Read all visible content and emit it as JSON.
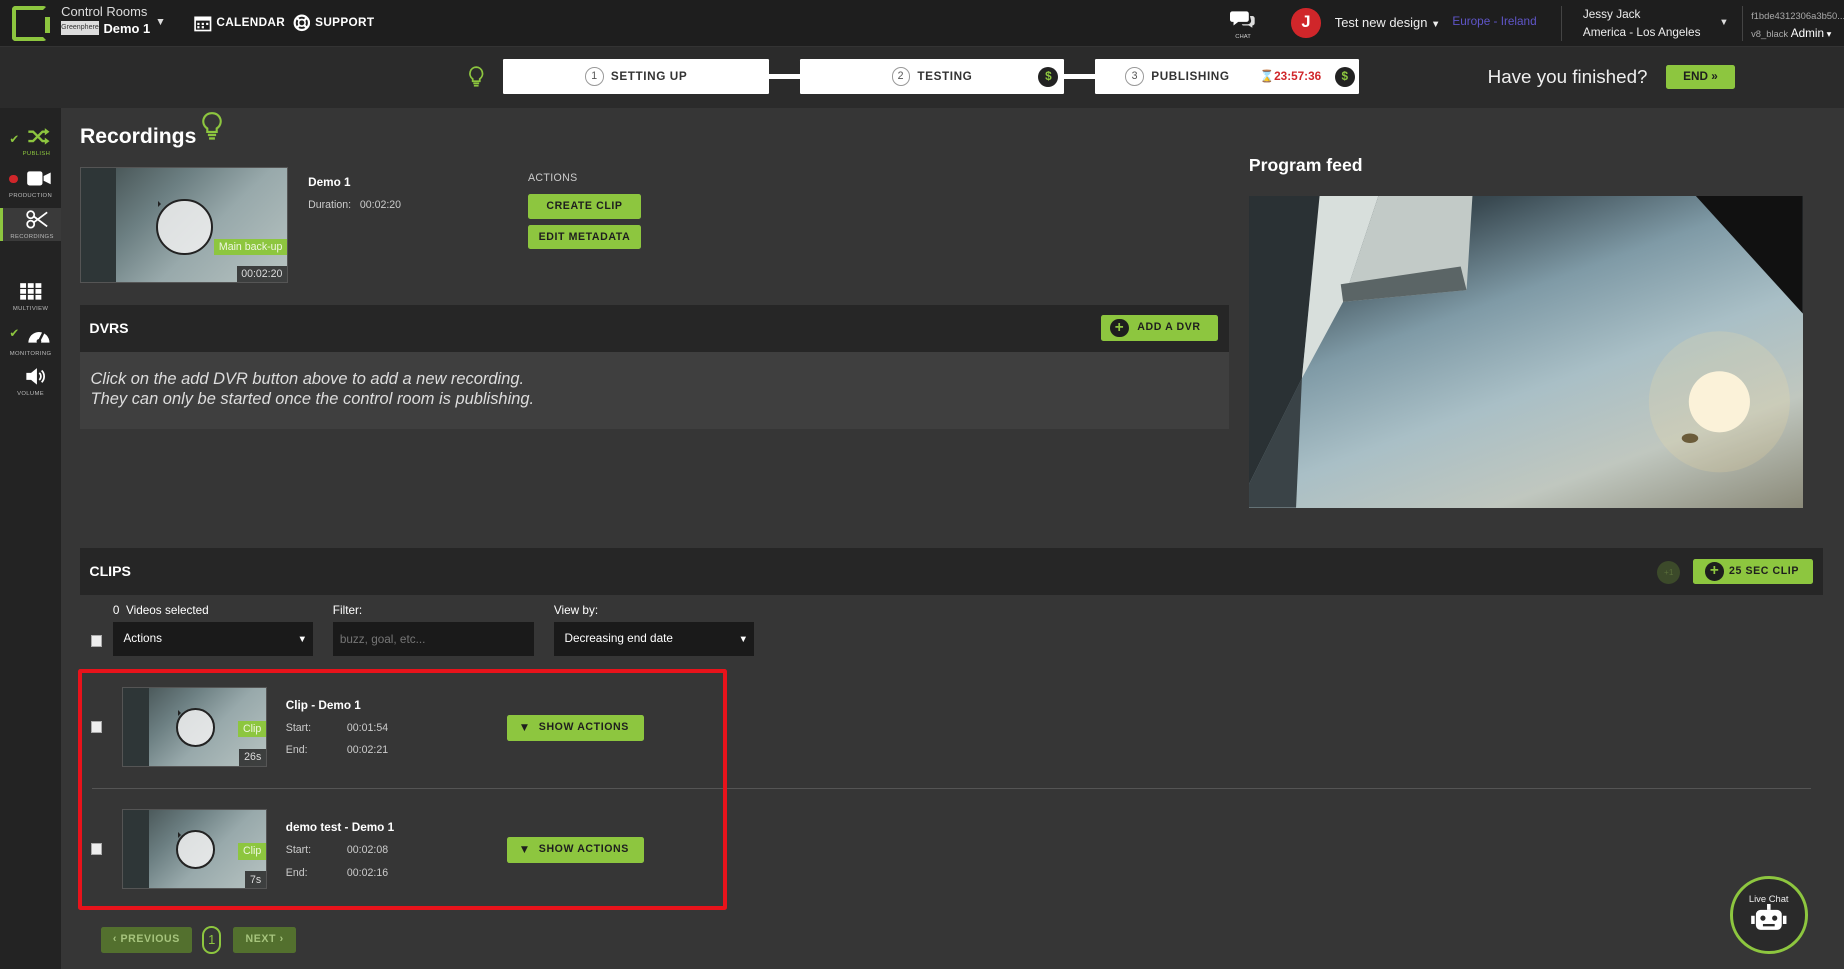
{
  "header": {
    "section_label": "Control Rooms",
    "mini_logo_text": "Greenphere",
    "room_name": "Demo 1",
    "calendar_label": "CALENDAR",
    "support_label": "SUPPORT",
    "chat_label": "CHAT",
    "avatar_letter": "J",
    "design_label": "Test new design",
    "region": "Europe - Ireland",
    "user_name": "Jessy Jack",
    "user_timezone": "America - Los Angeles",
    "instance_id": "f1bde4312306a3b50...",
    "instance_sub": "v8_black",
    "role": "Admin"
  },
  "steps": [
    {
      "num": "1",
      "label": "SETTING UP"
    },
    {
      "num": "2",
      "label": "TESTING"
    },
    {
      "num": "3",
      "label": "PUBLISHING"
    }
  ],
  "timer": "23:57:36",
  "dollar": "$",
  "finished_text": "Have you finished?",
  "end_label": "END",
  "sidebar": [
    {
      "label": "PUBLISH"
    },
    {
      "label": "PRODUCTION"
    },
    {
      "label": "RECORDINGS"
    },
    {
      "label": "MULTIVIEW"
    },
    {
      "label": "MONITORING"
    },
    {
      "label": "VOLUME"
    }
  ],
  "recordings": {
    "title": "Recordings",
    "item": {
      "tag": "Main back-up",
      "duration_badge": "00:02:20",
      "name": "Demo 1",
      "duration_label": "Duration:",
      "duration_value": "00:02:20"
    },
    "actions_heading": "ACTIONS",
    "create_clip": "CREATE CLIP",
    "edit_metadata": "EDIT METADATA"
  },
  "dvrs": {
    "title": "DVRS",
    "add_label": "ADD A DVR",
    "message_line1": "Click on the add DVR button above to add a new recording.",
    "message_line2": "They can only be started once the control room is publishing."
  },
  "program_feed": {
    "title": "Program feed"
  },
  "clips": {
    "title": "CLIPS",
    "plus_badge": "+1",
    "clip_button": "25 SEC CLIP",
    "selected_count": "0",
    "selected_label": "Videos selected",
    "actions_select": "Actions",
    "filter_label": "Filter:",
    "filter_placeholder": "buzz, goal, etc...",
    "viewby_label": "View by:",
    "viewby_value": "Decreasing end date",
    "items": [
      {
        "name": "Clip - Demo 1",
        "tag": "Clip",
        "len": "26s",
        "start_label": "Start:",
        "start": "00:01:54",
        "end_label": "End:",
        "end": "00:02:21",
        "action": "SHOW ACTIONS"
      },
      {
        "name": "demo test - Demo 1",
        "tag": "Clip",
        "len": "7s",
        "start_label": "Start:",
        "start": "00:02:08",
        "end_label": "End:",
        "end": "00:02:16",
        "action": "SHOW ACTIONS"
      }
    ]
  },
  "pagination": {
    "prev": "PREVIOUS",
    "page": "1",
    "next": "NEXT"
  },
  "livechat": {
    "label": "Live Chat"
  },
  "colors": {
    "accent": "#8dc63f",
    "alert": "#e8131b",
    "timer": "#d0262a",
    "region": "#5f55c8"
  }
}
